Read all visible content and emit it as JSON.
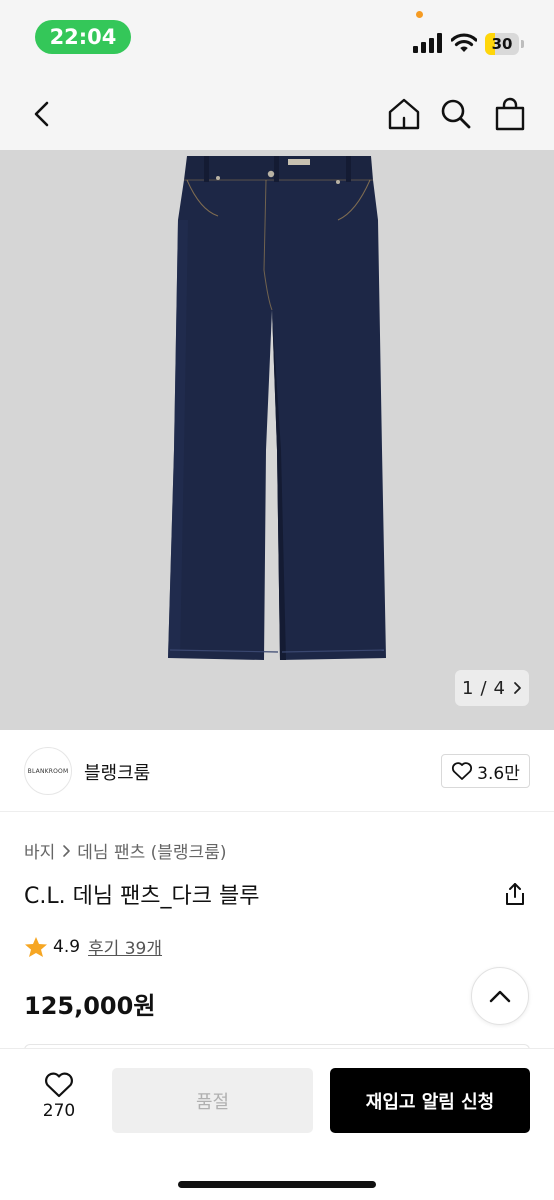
{
  "status_bar": {
    "time": "22:04",
    "battery_level": "30",
    "battery_fraction": 0.3,
    "colors": {
      "time_pill": "#34c759",
      "battery": "#ffd60a",
      "privacy_dot": "#f59b23"
    }
  },
  "nav": {
    "icons": [
      "chevron-left-icon",
      "home-icon",
      "search-icon",
      "shopping-bag-icon"
    ]
  },
  "gallery": {
    "image": "dark-indigo-denim-pants",
    "current": "1",
    "separator": "/",
    "total": "4"
  },
  "brand": {
    "logo_text": "BLANKROOM",
    "name": "블랭크룸",
    "likes": "3.6만"
  },
  "product": {
    "breadcrumb": [
      "바지",
      "데님 팬츠 (블랭크룸)"
    ],
    "title": "C.L. 데님 팬츠_다크 블루",
    "rating": "4.9",
    "reviews": "후기 39개",
    "price": "125,000원"
  },
  "bottom_bar": {
    "wish_count": "270",
    "soldout_label": "품절",
    "restock_label": "재입고 알림 신청"
  }
}
